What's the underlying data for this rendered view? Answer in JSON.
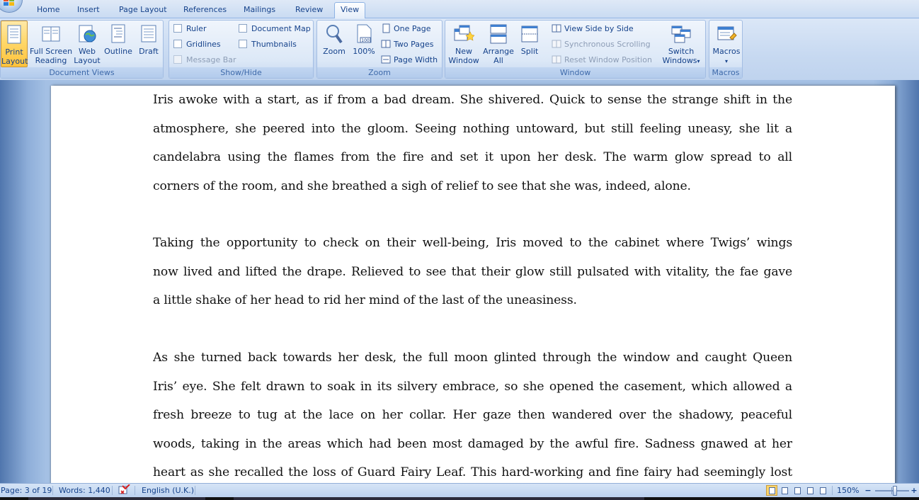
{
  "tabs": [
    {
      "label": "Home"
    },
    {
      "label": "Insert"
    },
    {
      "label": "Page Layout"
    },
    {
      "label": "References"
    },
    {
      "label": "Mailings"
    },
    {
      "label": "Review"
    },
    {
      "label": "View",
      "active": true
    }
  ],
  "ribbon": {
    "document_views": {
      "group_label": "Document Views",
      "print_layout": {
        "line1": "Print",
        "line2": "Layout",
        "pressed": true
      },
      "full_screen": {
        "line1": "Full Screen",
        "line2": "Reading"
      },
      "web_layout": {
        "line1": "Web",
        "line2": "Layout"
      },
      "outline": {
        "line1": "Outline"
      },
      "draft": {
        "line1": "Draft"
      }
    },
    "show_hide": {
      "group_label": "Show/Hide",
      "ruler": {
        "label": "Ruler",
        "checked": false
      },
      "gridlines": {
        "label": "Gridlines",
        "checked": false
      },
      "message_bar": {
        "label": "Message Bar",
        "checked": false,
        "disabled": true
      },
      "document_map": {
        "label": "Document Map",
        "checked": false
      },
      "thumbnails": {
        "label": "Thumbnails",
        "checked": false
      }
    },
    "zoom": {
      "group_label": "Zoom",
      "zoom_btn": {
        "line1": "Zoom"
      },
      "hundred_btn": {
        "line1": "100%",
        "icon_text": "100"
      },
      "one_page": "One Page",
      "two_pages": "Two Pages",
      "page_width": "Page Width"
    },
    "window": {
      "group_label": "Window",
      "new_window": {
        "line1": "New",
        "line2": "Window"
      },
      "arrange_all": {
        "line1": "Arrange",
        "line2": "All"
      },
      "split": {
        "line1": "Split"
      },
      "view_side_by_side": "View Side by Side",
      "sync_scrolling": "Synchronous Scrolling",
      "reset_window_position": "Reset Window Position",
      "switch_windows": {
        "line1": "Switch",
        "line2": "Windows",
        "dropdown": "▾"
      }
    },
    "macros": {
      "group_label": "Macros",
      "macros_btn": {
        "line1": "Macros",
        "dropdown": "▾"
      }
    }
  },
  "document": {
    "paragraphs": [
      {
        "lines": [
          "Iris awoke with a start, as if from a bad dream. She shivered. Quick to sense the strange shift in the",
          "atmosphere, she peered into the gloom. Seeing nothing untoward, but still feeling uneasy, she lit a",
          "candelabra using the flames from the fire and set it upon her desk. The warm glow spread to all",
          "corners of the room, and she breathed a sigh of relief to see that she was, indeed, alone."
        ]
      },
      {
        "lines": [
          "Taking the opportunity to check on their well-being, Iris moved to the cabinet where Twigs’ wings",
          "now lived and lifted the drape. Relieved to see that their glow still pulsated with vitality, the fae gave",
          "a little shake of her head to rid her mind of the last of the uneasiness."
        ]
      },
      {
        "lines": [
          "As she turned back towards her desk, the full moon glinted through the window and caught Queen",
          "Iris’ eye. She felt drawn to soak in its silvery embrace, so she opened the casement, which allowed a",
          "fresh breeze to tug at the lace on her collar. Her gaze then wandered over the shadowy, peaceful",
          "woods, taking in the areas which had been most damaged by the awful fire. Sadness gnawed at her",
          "heart as she recalled the loss of Guard Fairy Leaf. This hard-working and fine fairy had seemingly lost"
        ]
      }
    ]
  },
  "status": {
    "page": "Page: 3 of 19",
    "words": "Words: 1,440",
    "language": "English (U.K.)",
    "zoom": "150%",
    "zoom_minus": "−",
    "zoom_plus": "+",
    "zoom_level": 0.6
  },
  "colors": {
    "ribbon_text": "#15428b",
    "pressed_button": "#ffc23a",
    "doc_background": "#a4c0e4"
  }
}
